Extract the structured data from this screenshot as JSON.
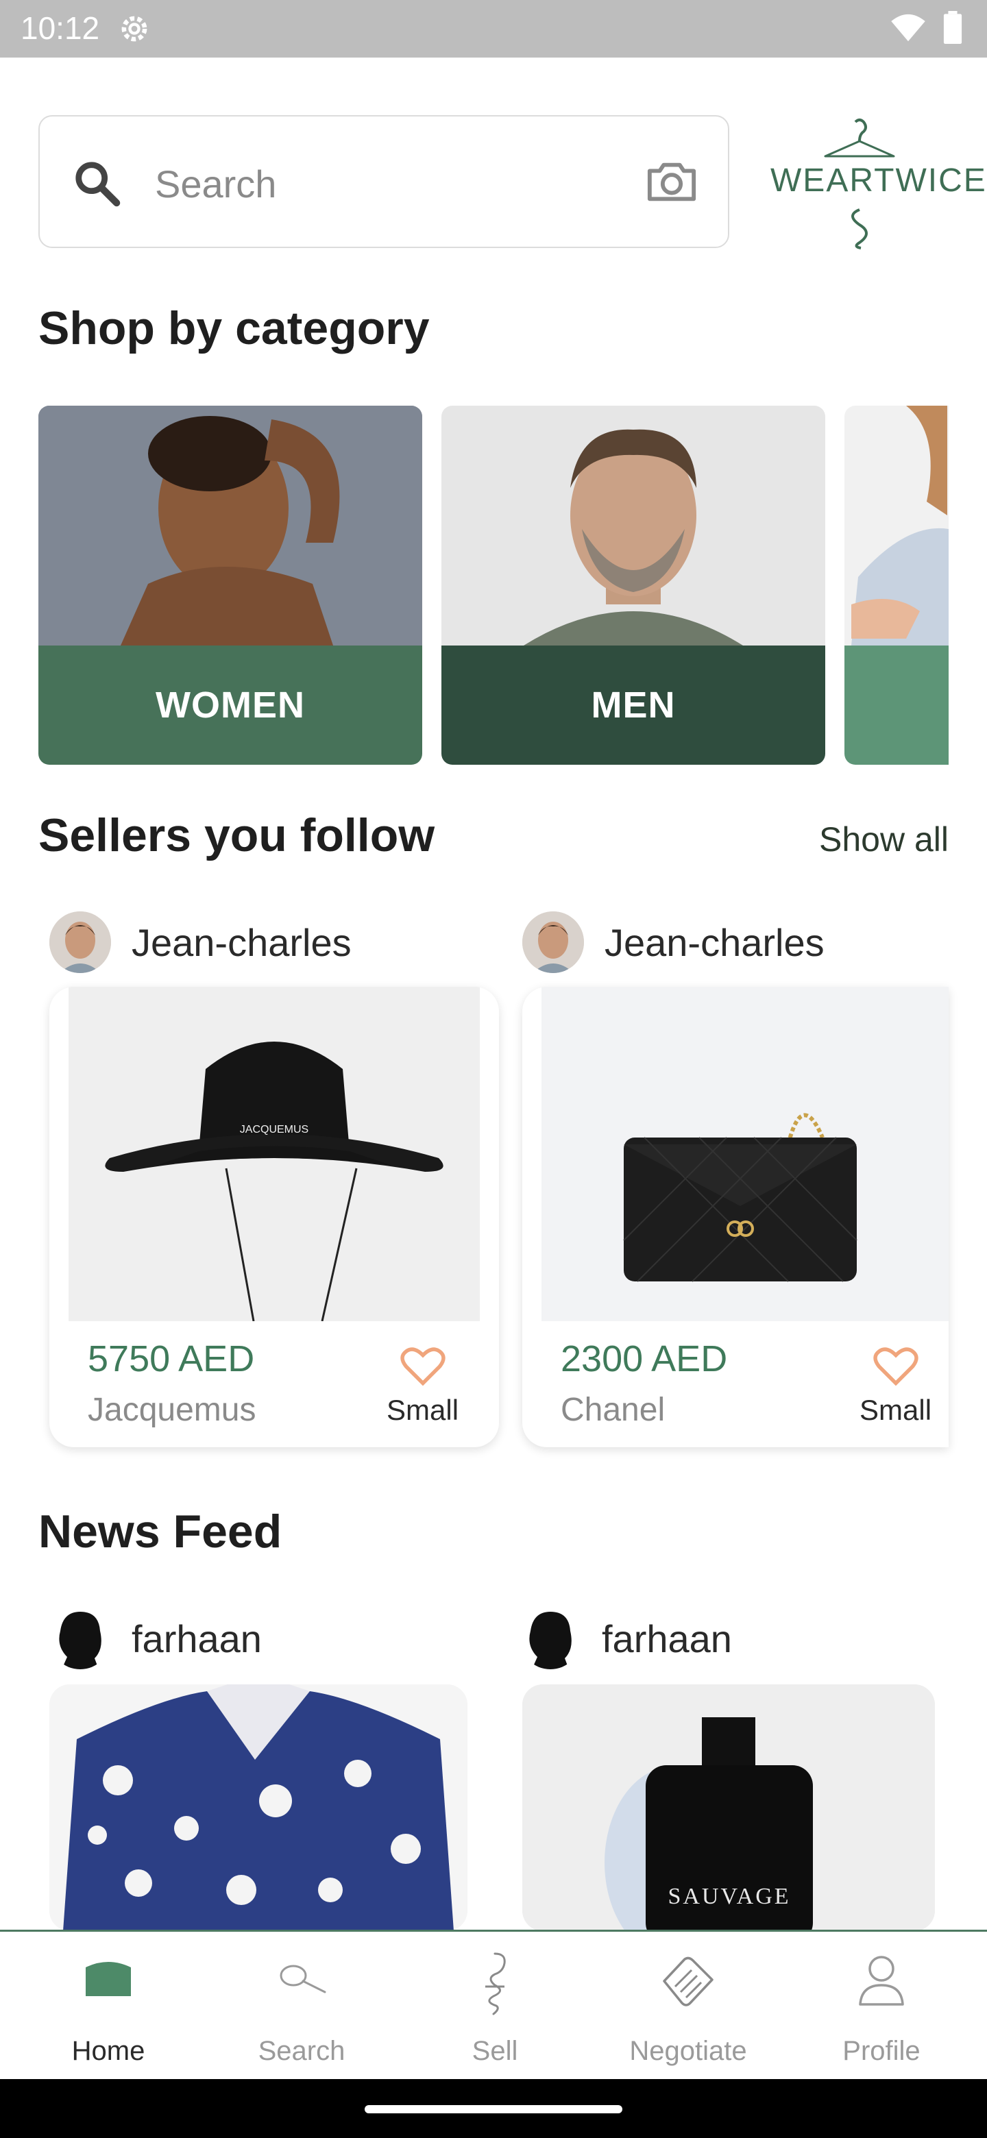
{
  "status_bar": {
    "time": "10:12"
  },
  "search": {
    "placeholder": "Search"
  },
  "brand": {
    "name": "WEARTWICE"
  },
  "categories": {
    "title": "Shop by category",
    "items": [
      {
        "label": "WOMEN",
        "color": "#477259"
      },
      {
        "label": "MEN",
        "color": "#2f4d3e"
      },
      {
        "label": "",
        "color": "#5d9577"
      }
    ]
  },
  "sellers": {
    "title": "Sellers you follow",
    "show_all": "Show all",
    "items": [
      {
        "seller": "Jean-charles",
        "price": "5750 AED",
        "brand": "Jacquemus",
        "size": "Small",
        "product": "bucket-hat"
      },
      {
        "seller": "Jean-charles",
        "price": "2300 AED",
        "brand": "Chanel",
        "size": "Small",
        "product": "quilted-handbag"
      }
    ]
  },
  "news_feed": {
    "title": "News Feed",
    "items": [
      {
        "user": "farhaan",
        "product": "floral-shirt"
      },
      {
        "user": "farhaan",
        "product": "perfume",
        "product_text": "SAUVAGE"
      }
    ]
  },
  "hat_text": "JACQUEMUS",
  "bottom_nav": {
    "items": [
      {
        "label": "Home",
        "icon": "home-icon",
        "active": true
      },
      {
        "label": "Search",
        "icon": "search-icon",
        "active": false
      },
      {
        "label": "Sell",
        "icon": "hanger-icon",
        "active": false
      },
      {
        "label": "Negotiate",
        "icon": "handshake-icon",
        "active": false
      },
      {
        "label": "Profile",
        "icon": "profile-icon",
        "active": false
      }
    ]
  },
  "colors": {
    "accent": "#3f7a5a",
    "heart": "#f0a57c"
  }
}
